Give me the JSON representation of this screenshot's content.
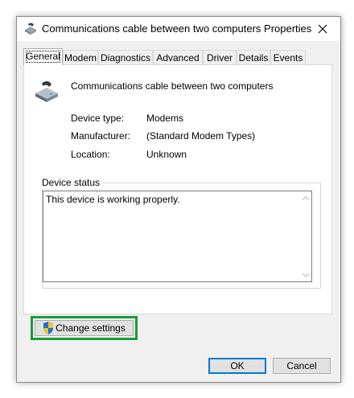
{
  "window": {
    "title": "Communications cable between two computers Properties"
  },
  "tabs": [
    "General",
    "Modem",
    "Diagnostics",
    "Advanced",
    "Driver",
    "Details",
    "Events"
  ],
  "active_tab": "General",
  "device": {
    "name": "Communications cable between two computers",
    "properties": [
      {
        "label": "Device type:",
        "value": "Modems"
      },
      {
        "label": "Manufacturer:",
        "value": "(Standard Modem Types)"
      },
      {
        "label": "Location:",
        "value": "Unknown"
      }
    ]
  },
  "device_status": {
    "legend": "Device status",
    "text": "This device is working properly."
  },
  "buttons": {
    "change_settings": "Change settings",
    "ok": "OK",
    "cancel": "Cancel"
  },
  "colors": {
    "highlight": "#1a9a3b",
    "default_button_border": "#0078d7"
  }
}
